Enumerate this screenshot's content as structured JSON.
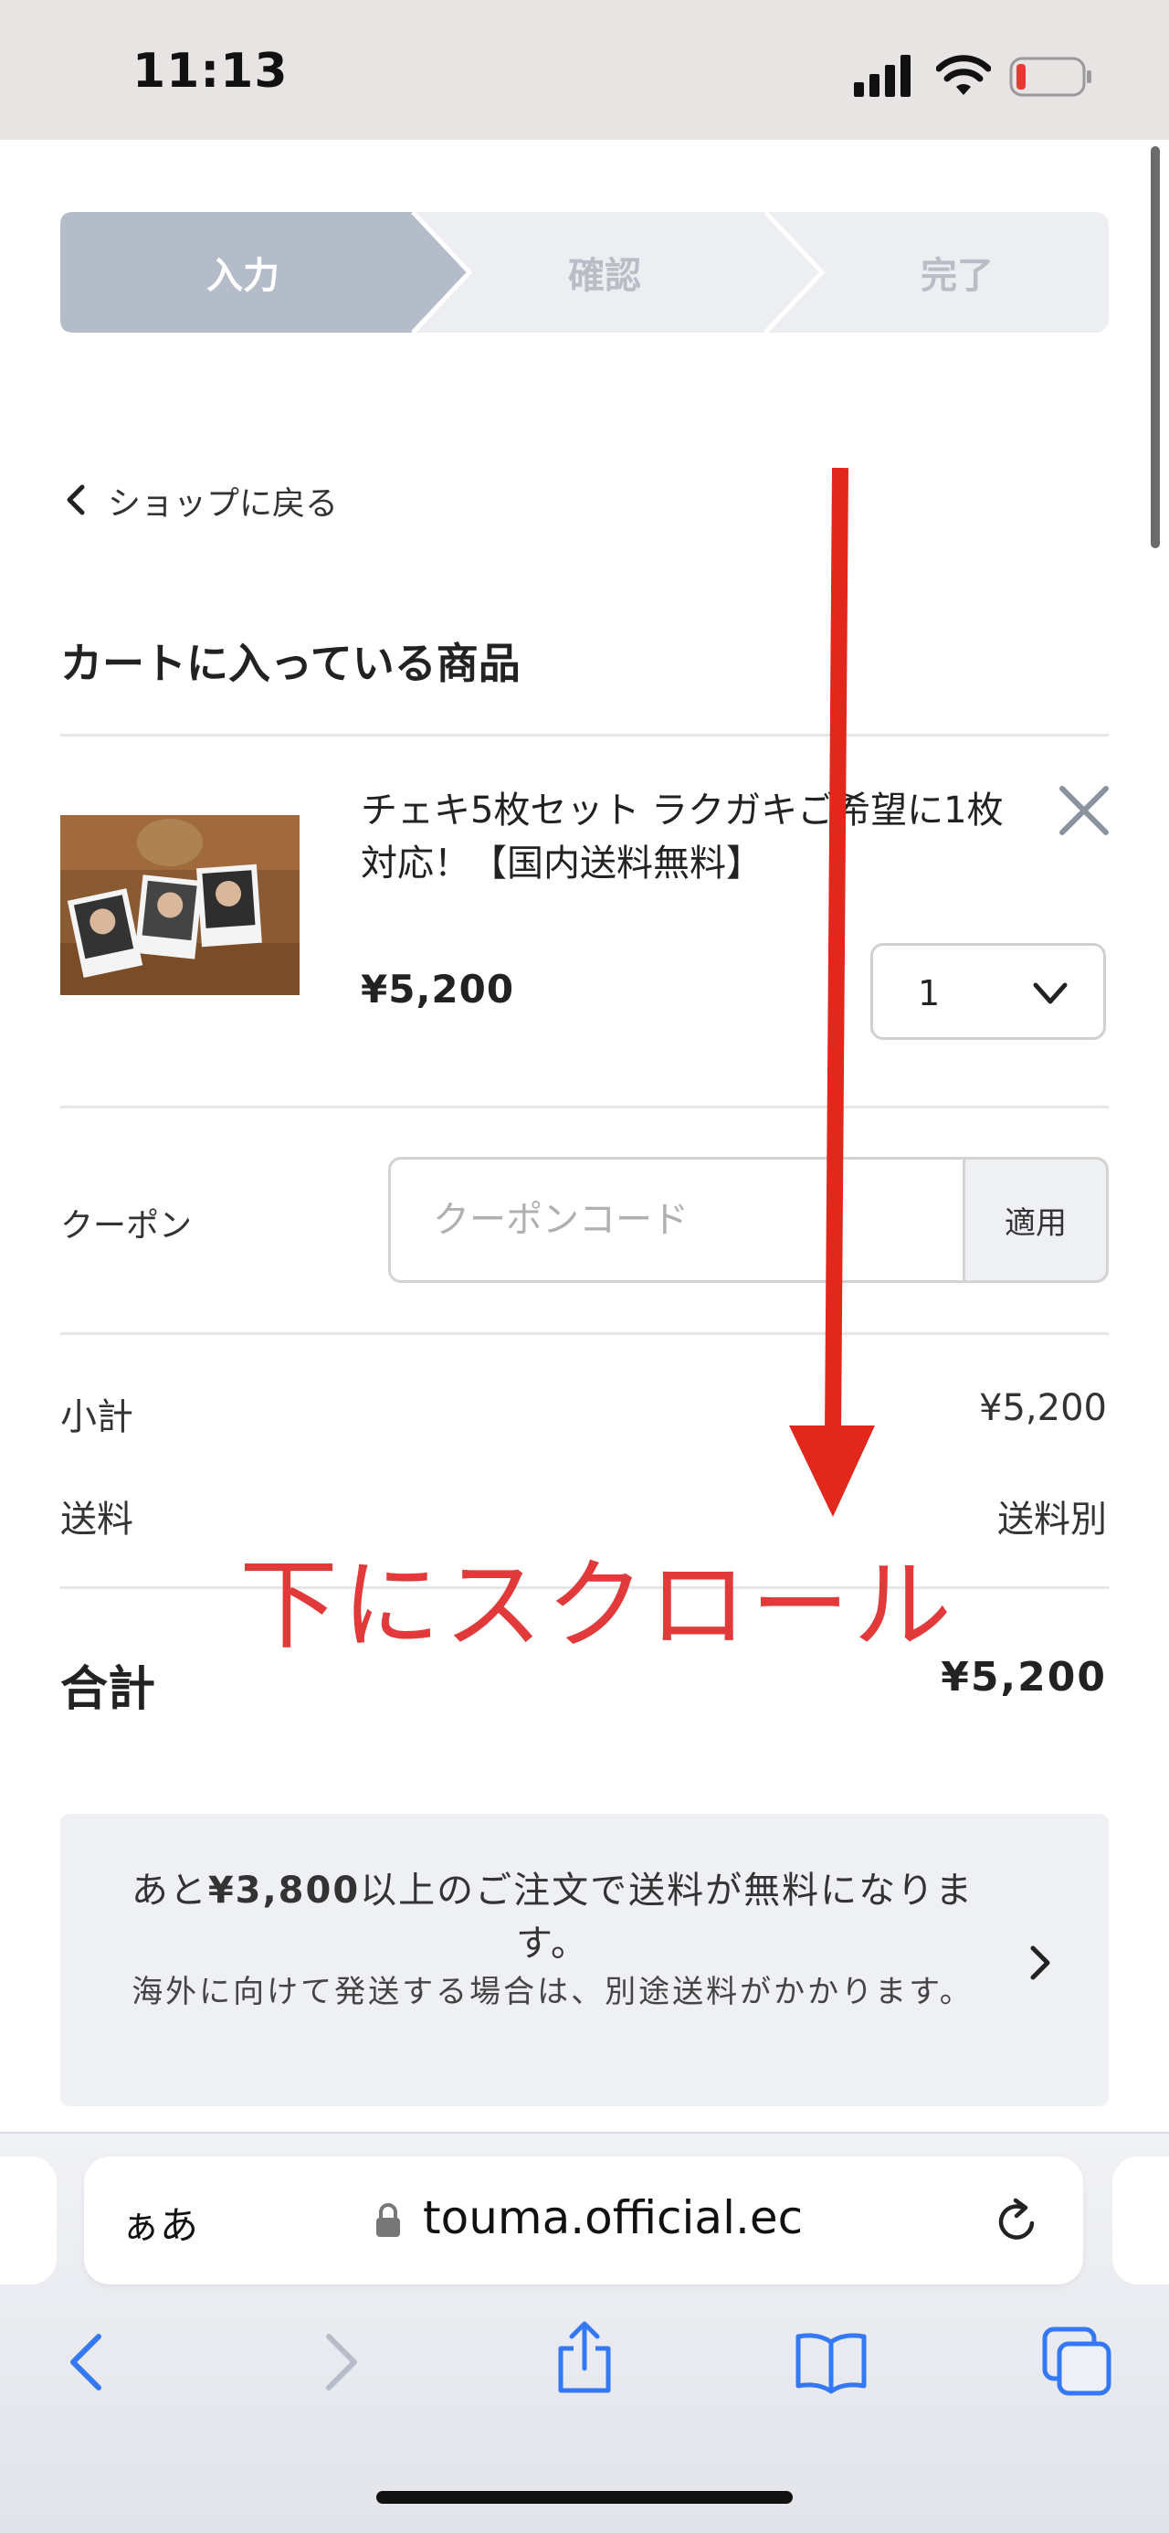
{
  "status_bar": {
    "time": "11:13"
  },
  "steps": {
    "step1": "入力",
    "step2": "確認",
    "step3": "完了"
  },
  "back_link": "ショップに戻る",
  "cart": {
    "title": "カートに入っている商品",
    "item": {
      "name": "チェキ5枚セット ラクガキご希望に1枚対応！【国内送料無料】",
      "price": "¥5,200",
      "quantity": "1"
    }
  },
  "coupon": {
    "label": "クーポン",
    "placeholder": "クーポンコード",
    "apply_label": "適用"
  },
  "summary": {
    "subtotal_label": "小計",
    "subtotal_value": "¥5,200",
    "shipping_label": "送料",
    "shipping_value": "送料別",
    "total_label": "合計",
    "total_value": "¥5,200"
  },
  "notice": {
    "line1_prefix": "あと",
    "line1_amount": "¥3,800",
    "line1_suffix": "以上のご注文で送料が無料になります。",
    "line2": "海外に向けて発送する場合は、別途送料がかかります。"
  },
  "annotation": {
    "scroll_note": "下にスクロール",
    "color": "#e23a3a"
  },
  "browser": {
    "aa_label": "ぁあ",
    "url": "touma.official.ec"
  },
  "colors": {
    "step_active": "#b3bcc8",
    "step_inactive": "#eceef1",
    "notice_bg": "#eef0f4",
    "ios_blue": "#3478f6"
  }
}
